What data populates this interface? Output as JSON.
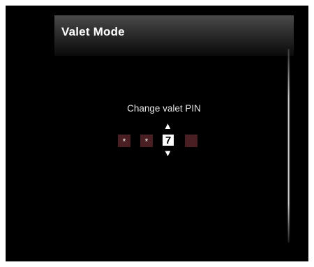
{
  "header": {
    "title": "Valet Mode"
  },
  "pin": {
    "prompt": "Change valet PIN",
    "digits": [
      {
        "value": "*",
        "state": "entered"
      },
      {
        "value": "*",
        "state": "entered"
      },
      {
        "value": "7",
        "state": "active"
      },
      {
        "value": "",
        "state": "empty"
      }
    ],
    "increment_icon": "up-arrow",
    "decrement_icon": "down-arrow"
  },
  "colors": {
    "background": "#000000",
    "digit_box": "#4a1f24",
    "active_digit_bg": "#ffffff",
    "text": "#ffffff"
  }
}
